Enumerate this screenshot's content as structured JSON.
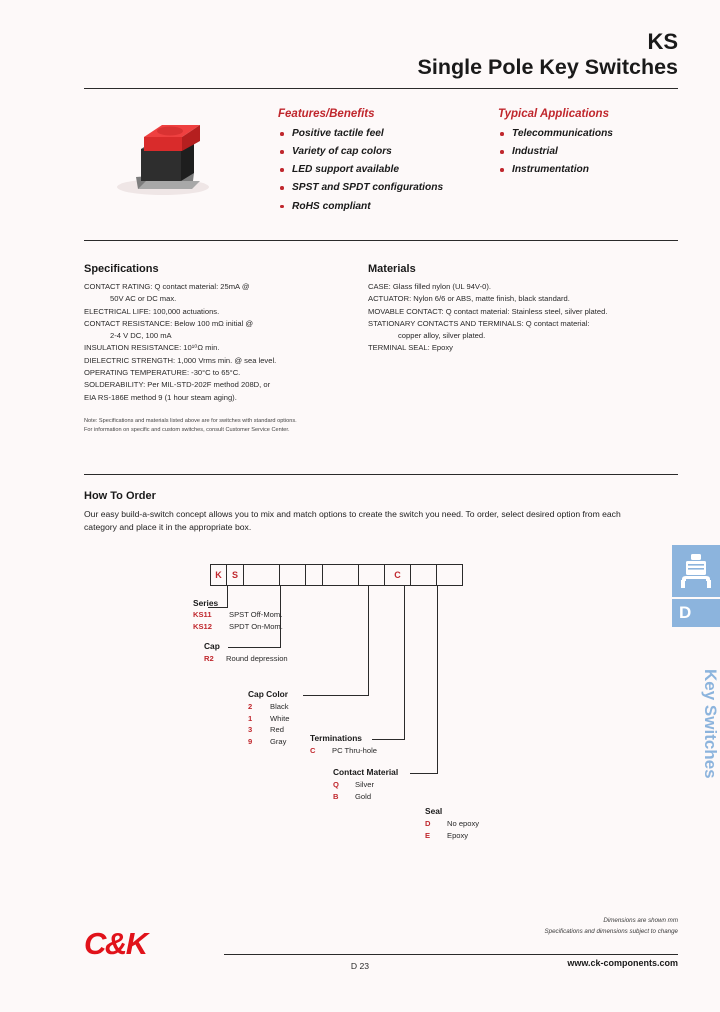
{
  "header": {
    "series_code": "KS",
    "title": "Single Pole Key Switches"
  },
  "features": {
    "heading": "Features/Benefits",
    "items": [
      "Positive tactile feel",
      "Variety of cap colors",
      "LED support available",
      "SPST and SPDT configurations",
      "RoHS compliant"
    ]
  },
  "applications": {
    "heading": "Typical Applications",
    "items": [
      "Telecommunications",
      "Industrial",
      "Instrumentation"
    ]
  },
  "specifications": {
    "heading": "Specifications",
    "lines": [
      {
        "text": "CONTACT RATING: Q contact material: 25mA @",
        "indent": 0
      },
      {
        "text": "50V AC or DC max.",
        "indent": 1
      },
      {
        "text": "ELECTRICAL LIFE: 100,000 actuations.",
        "indent": 0
      },
      {
        "text": "CONTACT RESISTANCE: Below 100 mΩ initial @",
        "indent": 0
      },
      {
        "text": "2-4 V DC, 100 mA",
        "indent": 1
      },
      {
        "text": "INSULATION RESISTANCE: 10¹⁰Ω min.",
        "indent": 0
      },
      {
        "text": "DIELECTRIC STRENGTH: 1,000 Vrms min. @ sea level.",
        "indent": 0
      },
      {
        "text": "OPERATING TEMPERATURE: -30°C to 65°C.",
        "indent": 0
      },
      {
        "text": "SOLDERABILITY: Per MIL-STD-202F method 208D, or",
        "indent": 0
      },
      {
        "text": "EIA RS-186E method 9 (1 hour steam aging).",
        "indent": 0
      }
    ],
    "note_line1": "Note: Specifications and materials listed above are for switches with standard options.",
    "note_line2": "For information on specific and custom switches, consult Customer Service Center."
  },
  "materials": {
    "heading": "Materials",
    "lines": [
      {
        "text": "CASE: Glass filled nylon (UL 94V-0).",
        "indent": 0
      },
      {
        "text": "ACTUATOR: Nylon 6/6 or ABS, matte finish, black standard.",
        "indent": 0
      },
      {
        "text": "MOVABLE CONTACT: Q contact material: Stainless steel, silver plated.",
        "indent": 0
      },
      {
        "text": "STATIONARY CONTACTS AND TERMINALS: Q contact material:",
        "indent": 0
      },
      {
        "text": "copper alloy, silver plated.",
        "indent": 1
      },
      {
        "text": "TERMINAL SEAL: Epoxy",
        "indent": 0
      }
    ]
  },
  "how_to_order": {
    "heading": "How To Order",
    "intro": "Our easy build-a-switch concept allows you to mix and match options to create the switch you need. To order, select desired option from each category and place it in the appropriate box.",
    "part_number_cells": [
      "K",
      "S",
      "",
      "",
      "",
      "",
      "",
      "C",
      "",
      ""
    ]
  },
  "option_groups": {
    "series": {
      "title": "Series",
      "rows": [
        {
          "code": "KS11",
          "desc": "SPST Off-Mom."
        },
        {
          "code": "KS12",
          "desc": "SPDT On-Mom."
        }
      ]
    },
    "cap": {
      "title": "Cap",
      "rows": [
        {
          "code": "R2",
          "desc": "Round depression"
        }
      ]
    },
    "cap_color": {
      "title": "Cap Color",
      "rows": [
        {
          "code": "2",
          "desc": "Black"
        },
        {
          "code": "1",
          "desc": "White"
        },
        {
          "code": "3",
          "desc": "Red"
        },
        {
          "code": "9",
          "desc": "Gray"
        }
      ]
    },
    "terminations": {
      "title": "Terminations",
      "rows": [
        {
          "code": "C",
          "desc": "PC Thru-hole"
        }
      ]
    },
    "contact_material": {
      "title": "Contact Material",
      "rows": [
        {
          "code": "Q",
          "desc": "Silver"
        },
        {
          "code": "B",
          "desc": "Gold"
        }
      ]
    },
    "seal": {
      "title": "Seal",
      "rows": [
        {
          "code": "D",
          "desc": "No epoxy"
        },
        {
          "code": "E",
          "desc": "Epoxy"
        }
      ]
    }
  },
  "side_tab": {
    "letter": "D",
    "label": "Key Switches",
    "color": "#8cb4dd"
  },
  "footer": {
    "logo": "C&K",
    "note_line1": "Dimensions are shown mm",
    "note_line2": "Specifications and dimensions subject to change",
    "page": "D 23",
    "url": "www.ck-components.com"
  }
}
